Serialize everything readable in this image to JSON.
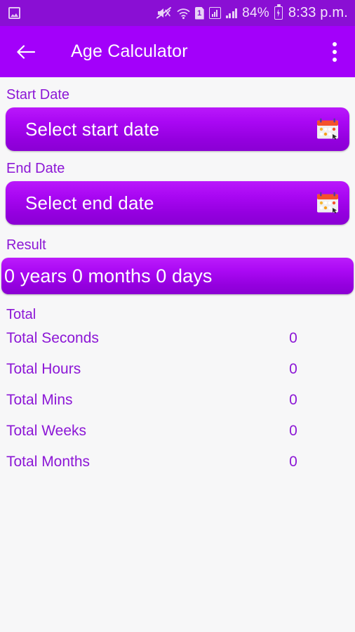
{
  "status_bar": {
    "notification_icon": "photo-icon",
    "icons": [
      "mute-icon",
      "wifi-icon",
      "sim-1-icon",
      "signal-box-icon",
      "signal-bars-icon"
    ],
    "sim_label": "1",
    "battery_percent": "84%",
    "battery_icon": "charging-battery-icon",
    "time": "8:33 p.m.",
    "background_color": "#8a0fd4"
  },
  "app_bar": {
    "back_icon": "back-arrow-icon",
    "title": "Age Calculator",
    "overflow_icon": "more-vertical-icon",
    "background_color": "#a300fa"
  },
  "form": {
    "start": {
      "label": "Start Date",
      "button_text": "Select start date",
      "icon": "calendar-icon"
    },
    "end": {
      "label": "End Date",
      "button_text": "Select end date",
      "icon": "calendar-icon"
    }
  },
  "result": {
    "label": "Result",
    "value": "0 years  0 months  0 days"
  },
  "totals": {
    "header": "Total",
    "rows": [
      {
        "label": "Total Seconds",
        "value": "0"
      },
      {
        "label": "Total Hours",
        "value": "0"
      },
      {
        "label": "Total Mins",
        "value": "0"
      },
      {
        "label": "Total Weeks",
        "value": "0"
      },
      {
        "label": "Total Months",
        "value": "0"
      }
    ]
  },
  "theme": {
    "accent": "#8c17d6",
    "button_gradient_top": "#ba18fb",
    "button_gradient_bottom": "#8a00d4",
    "page_background": "#f7f7f8"
  }
}
